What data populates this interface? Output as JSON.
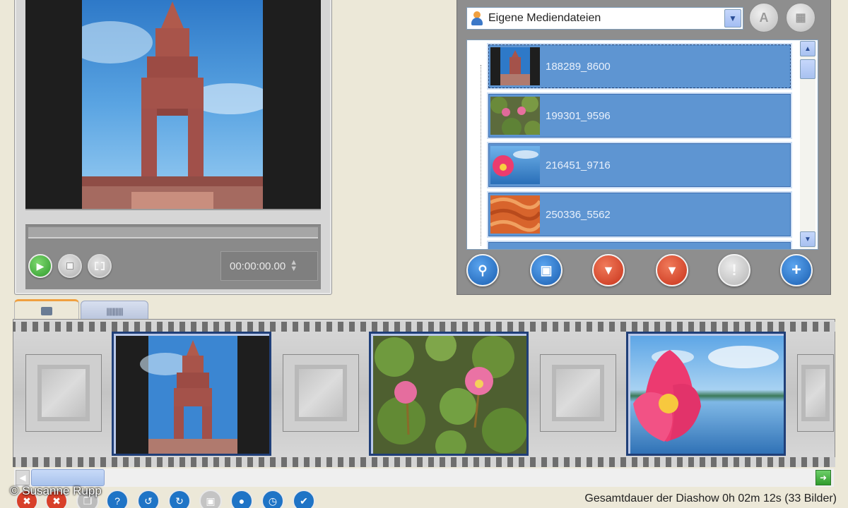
{
  "preview": {
    "time": "00:00:00.00"
  },
  "media_browser": {
    "source_label": "Eigene Mediendateien",
    "items": [
      {
        "label": "188289_8600"
      },
      {
        "label": "199301_9596"
      },
      {
        "label": "216451_9716"
      },
      {
        "label": "250336_5562"
      }
    ]
  },
  "footer": {
    "status": "Gesamtdauer der Diashow  0h 02m 12s (33 Bilder)",
    "copyright": "© Susanne Rupp"
  },
  "colors": {
    "selection_blue": "#5e95d2",
    "play_green": "#3ca53a",
    "delete_red": "#e04a2a",
    "action_blue": "#1f74c6"
  }
}
